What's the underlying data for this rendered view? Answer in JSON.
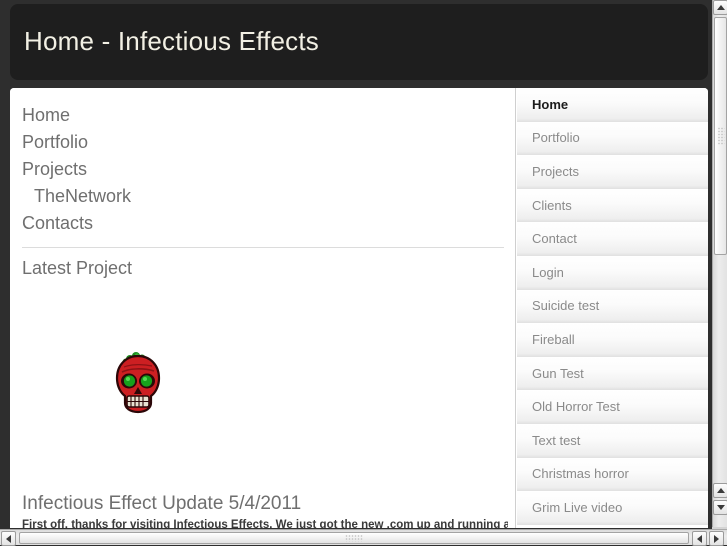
{
  "header": {
    "title": "Home - Infectious Effects",
    "background_color": "#1e1e1e",
    "text_color": "#f2f0e4"
  },
  "main": {
    "nav_links": [
      {
        "label": "Home",
        "indented": false
      },
      {
        "label": "Portfolio",
        "indented": false
      },
      {
        "label": "Projects",
        "indented": false
      },
      {
        "label": "TheNetwork",
        "indented": true
      },
      {
        "label": "Contacts",
        "indented": false
      }
    ],
    "section_title": "Latest Project",
    "featured_image_alt": "red-skull-logo",
    "article": {
      "heading": "Infectious Effect Update 5/4/2011",
      "body": "First off, thanks for visiting Infectious Effects. We just got the new .com up and running and"
    }
  },
  "sidebar": {
    "items": [
      {
        "label": "Home",
        "active": true
      },
      {
        "label": "Portfolio",
        "active": false
      },
      {
        "label": "Projects",
        "active": false
      },
      {
        "label": "Clients",
        "active": false
      },
      {
        "label": "Contact",
        "active": false
      },
      {
        "label": "Login",
        "active": false
      },
      {
        "label": "Suicide test",
        "active": false
      },
      {
        "label": "Fireball",
        "active": false
      },
      {
        "label": "Gun Test",
        "active": false
      },
      {
        "label": "Old Horror Test",
        "active": false
      },
      {
        "label": "Text test",
        "active": false
      },
      {
        "label": "Christmas horror",
        "active": false
      },
      {
        "label": "Grim Live video",
        "active": false
      }
    ]
  },
  "scrollbars": {
    "vertical": {
      "thumb_top_pct": 3,
      "thumb_height_pct": 45
    },
    "horizontal": {
      "thumb_left_pct": 3,
      "thumb_width_pct": 94
    }
  },
  "colors": {
    "page_background": "#2e2e2e",
    "card_background": "#ffffff",
    "link_gray": "#6f6f6f",
    "sidebar_gray": "#8a8a8a",
    "skull_red": "#cc1f22",
    "skull_eye_green": "#17a11c"
  }
}
